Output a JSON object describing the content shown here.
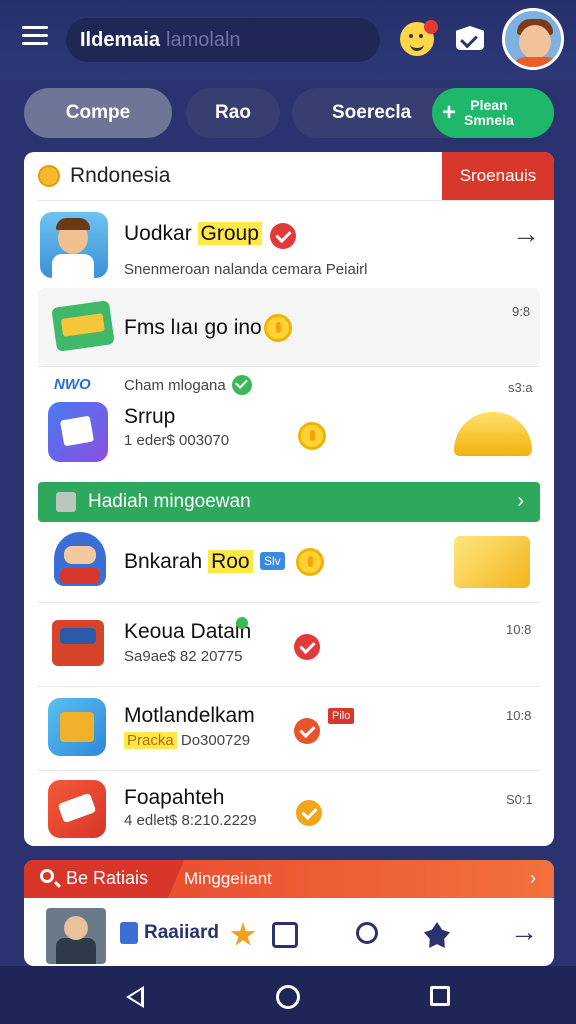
{
  "header": {
    "search_text": "Ildemaia",
    "search_placeholder": "lamolaln"
  },
  "tabs": [
    {
      "label": "Compe"
    },
    {
      "label": "Rao"
    },
    {
      "label": "Soerecla"
    },
    {
      "label_line1": "Plean",
      "label_line2": "Smneia"
    }
  ],
  "card": {
    "title": "Rndonesia",
    "action": "Sroenauis",
    "rows": [
      {
        "title": "Uodkar",
        "highlight": "Group",
        "subtitle": "Snenmeroan nalanda cemara Peiairl"
      },
      {
        "title": "Fms lıaı go ino",
        "time": "9:8"
      },
      {
        "brand": "NWO",
        "caption": "Cham mlogana",
        "title": "Srrup",
        "subtitle": "1 eder$ 003070",
        "time": "s3:a"
      },
      {
        "title": "Bnkarah",
        "highlight": "Roo",
        "badge": "Slv"
      },
      {
        "title": "Keoua Dataln",
        "subtitle": "Sa9ae$ 82 20775",
        "time": "10:8"
      },
      {
        "title": "Motlandelkam",
        "highlight": "Pracka",
        "subtitle": "Do300729",
        "tag": "Pilo",
        "time": "10:8"
      },
      {
        "title": "Foapahteh",
        "subtitle": "4 edlet$ 8:210.2229",
        "time": "S0:1"
      }
    ],
    "banner": "Hadiah mingoewan"
  },
  "panel2": {
    "left_label": "Be Ratiais",
    "right_label": "Minggeiıant",
    "item_label": "Raaiiard"
  },
  "colors": {
    "primary": "#2a3370",
    "green": "#2ea85c",
    "red": "#d8382b",
    "gold": "#f5b82e"
  }
}
